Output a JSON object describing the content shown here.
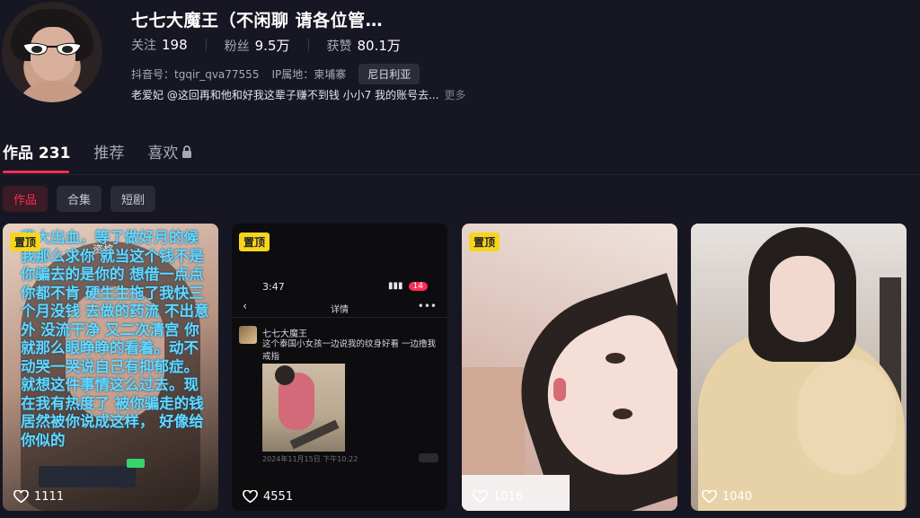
{
  "profile": {
    "name": "七七大魔王（不闲聊 请各位管…",
    "stats": {
      "following_label": "关注",
      "following_value": "198",
      "fans_label": "粉丝",
      "fans_value": "9.5万",
      "likes_label": "获赞",
      "likes_value": "80.1万"
    },
    "douyin_id": "抖音号：tgqir_qva77555",
    "ip_location": "IP属地：柬埔寨",
    "country_badge": "尼日利亚",
    "bio": "老爱妃 @这回再和他和好我这辈子赚不到钱 小小7 我的账号去...",
    "bio_more": "更多"
  },
  "tabs": {
    "works": "作品 231",
    "recommend": "推荐",
    "likes": "喜欢"
  },
  "subtabs": {
    "works": "作品",
    "collection": "合集",
    "short_drama": "短剧"
  },
  "cards": [
    {
      "pinned_label": "置顶",
      "likes": "1111",
      "overlay_text": "我大出血，等了做好月的候我那么求你 就当这个钱不是你骗去的是你的 想借一点点你都不肯 硬生生拖了我快三个月没钱 去做的药流 不出意外 没流干净 又二次清宫 你就那么眼睁睁的看着。动不动哭一哭说自己有抑郁症。就想这件事情这么过去。现在我有热度了 被你骗走的钱 居然被你说成这样， 好像给你似的",
      "watermark": "资格"
    },
    {
      "pinned_label": "置顶",
      "likes": "4551",
      "status_time": "3:47",
      "battery": "14",
      "nav_title": "详情",
      "post_author": "七七大魔王",
      "post_text": "这个泰国小女孩一边说我的纹身好看 一边撸我戒指",
      "post_date": "2024年11月15日 下午10:22"
    },
    {
      "pinned_label": "置顶",
      "likes": "1016"
    },
    {
      "likes": "1040"
    }
  ],
  "colors": {
    "background": "#161722",
    "accent": "#fe2c55",
    "pin_yellow": "#f7d51d",
    "overlay_text_blue": "#63d8ff"
  }
}
